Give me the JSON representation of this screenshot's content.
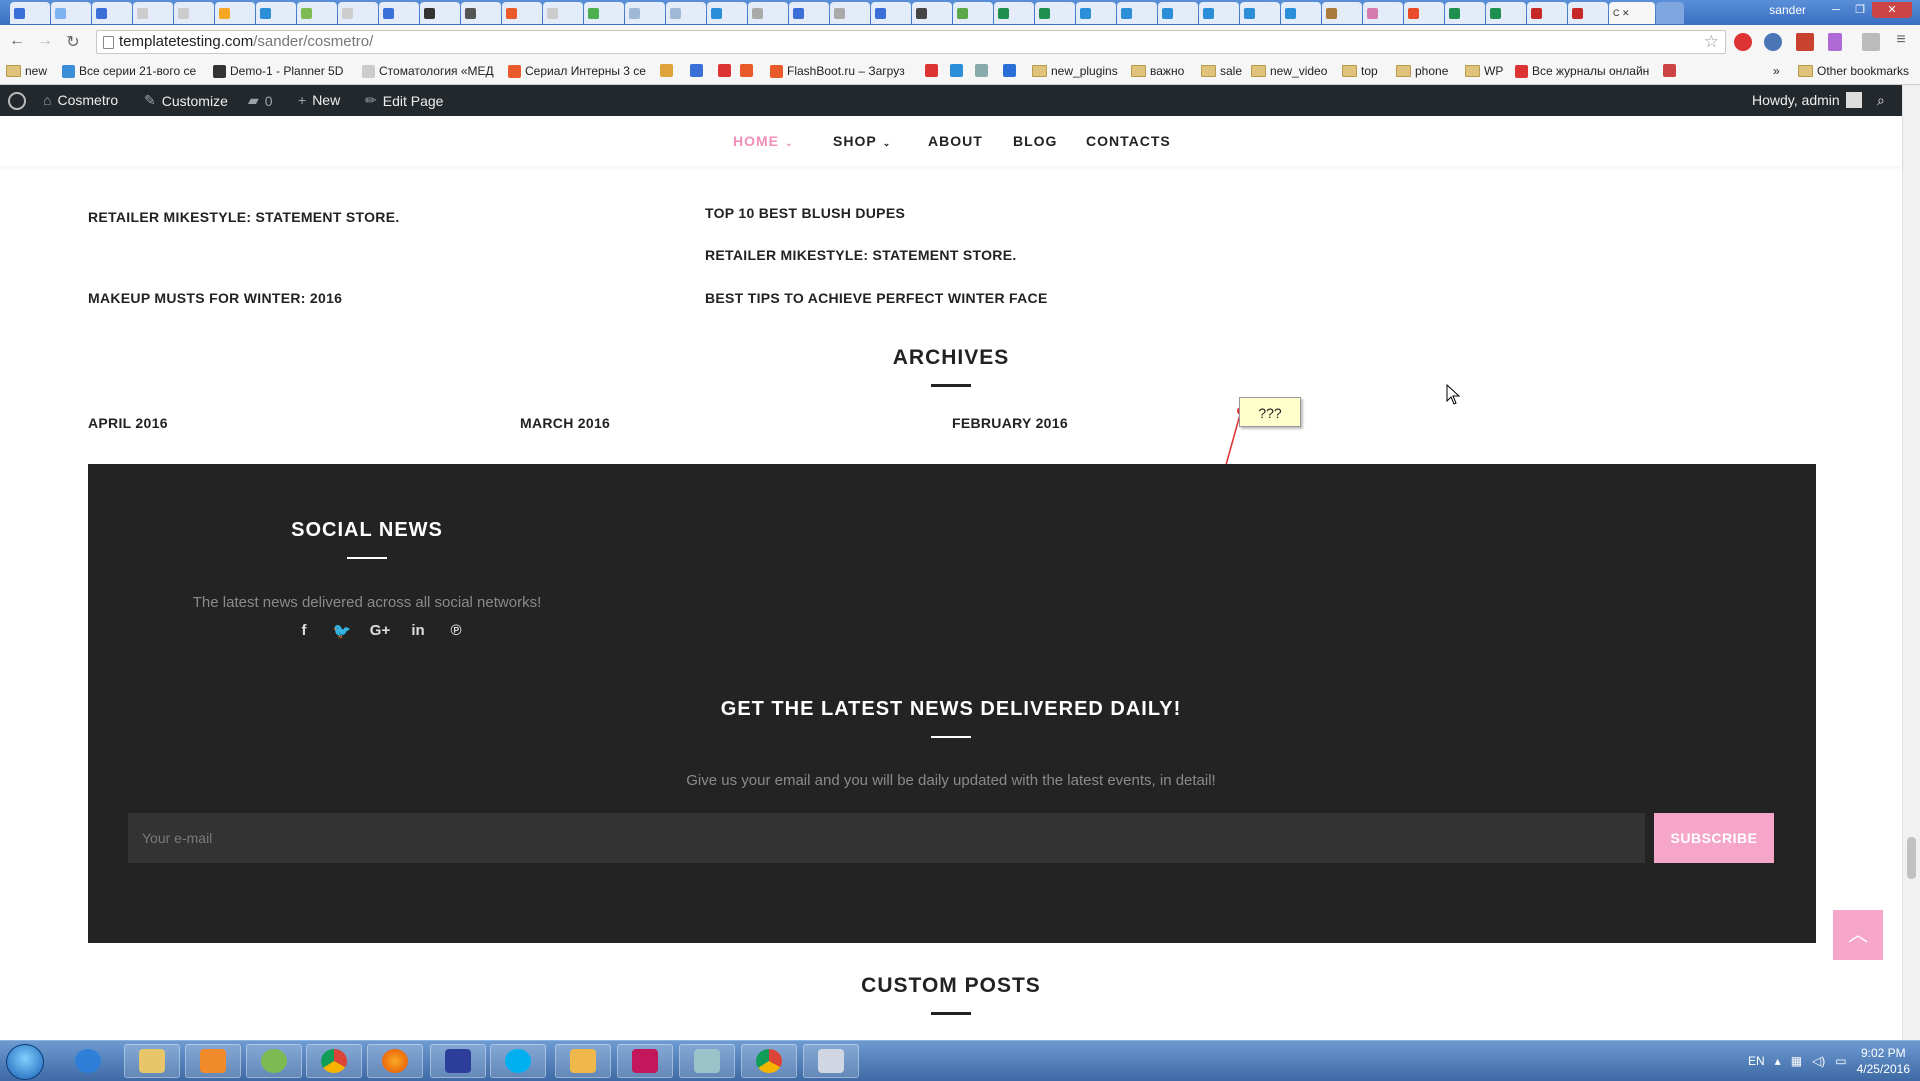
{
  "browser": {
    "tab_count_shown": 46,
    "active_tab_label": "C",
    "window_user": "sander",
    "url_host": "templatetesting.com",
    "url_path": "/sander/cosmetro/",
    "bookmarks": [
      {
        "label": "new",
        "kind": "folder"
      },
      {
        "label": "Все серии 21-вого се",
        "kind": "site"
      },
      {
        "label": "Demo-1 - Planner 5D",
        "kind": "site"
      },
      {
        "label": "Стоматология «МЕД",
        "kind": "site"
      },
      {
        "label": "Сериал Интерны 3 се",
        "kind": "site"
      },
      {
        "label": "FlashBoot.ru – Загруз",
        "kind": "site"
      },
      {
        "label": "new_plugins",
        "kind": "folder"
      },
      {
        "label": "важно",
        "kind": "folder"
      },
      {
        "label": "sale",
        "kind": "folder"
      },
      {
        "label": "new_video",
        "kind": "folder"
      },
      {
        "label": "top",
        "kind": "folder"
      },
      {
        "label": "phone",
        "kind": "folder"
      },
      {
        "label": "WP",
        "kind": "folder"
      },
      {
        "label": "Все журналы онлайн",
        "kind": "site"
      }
    ],
    "other_bookmarks": "Other bookmarks",
    "more_glyph": "»"
  },
  "adminbar": {
    "site_name": "Cosmetro",
    "customize": "Customize",
    "comments_count": "0",
    "new_label": "New",
    "edit_page": "Edit Page",
    "howdy": "Howdy, admin"
  },
  "nav": {
    "items": [
      {
        "label": "HOME",
        "dropdown": true,
        "active": true
      },
      {
        "label": "SHOP",
        "dropdown": true,
        "active": false
      },
      {
        "label": "ABOUT",
        "dropdown": false,
        "active": false
      },
      {
        "label": "BLOG",
        "dropdown": false,
        "active": false
      },
      {
        "label": "CONTACTS",
        "dropdown": false,
        "active": false
      }
    ]
  },
  "posts": {
    "left": [
      "RETAILER MIKESTYLE: STATEMENT STORE.",
      "MAKEUP MUSTS FOR WINTER: 2016"
    ],
    "right": [
      "TOP 10 BEST BLUSH DUPES",
      "RETAILER MIKESTYLE: STATEMENT STORE.",
      "BEST TIPS TO ACHIEVE PERFECT WINTER FACE"
    ]
  },
  "archives": {
    "title": "ARCHIVES",
    "items": [
      "APRIL 2016",
      "MARCH 2016",
      "FEBRUARY 2016"
    ]
  },
  "annotation": {
    "text": "???"
  },
  "social": {
    "title": "SOCIAL NEWS",
    "description": "The latest news delivered across all social networks!",
    "icons": [
      {
        "name": "facebook",
        "glyph": "f"
      },
      {
        "name": "twitter",
        "glyph": "🐦"
      },
      {
        "name": "google-plus",
        "glyph": "G+"
      },
      {
        "name": "linkedin",
        "glyph": "in"
      },
      {
        "name": "pinterest",
        "glyph": "℗"
      }
    ]
  },
  "newsletter": {
    "title": "GET THE LATEST NEWS DELIVERED DAILY!",
    "description": "Give us your email and you will be daily updated with the latest events, in detail!",
    "placeholder": "Your e-mail",
    "button": "SUBSCRIBE"
  },
  "custom_posts": {
    "title": "CUSTOM POSTS"
  },
  "taskbar": {
    "language": "EN",
    "time": "9:02 PM",
    "date": "4/25/2016"
  },
  "colors": {
    "accent_pink": "#f18fb8",
    "button_pink": "#f6a6c8",
    "dark_block": "#232323",
    "admin_bar": "#23282d"
  }
}
